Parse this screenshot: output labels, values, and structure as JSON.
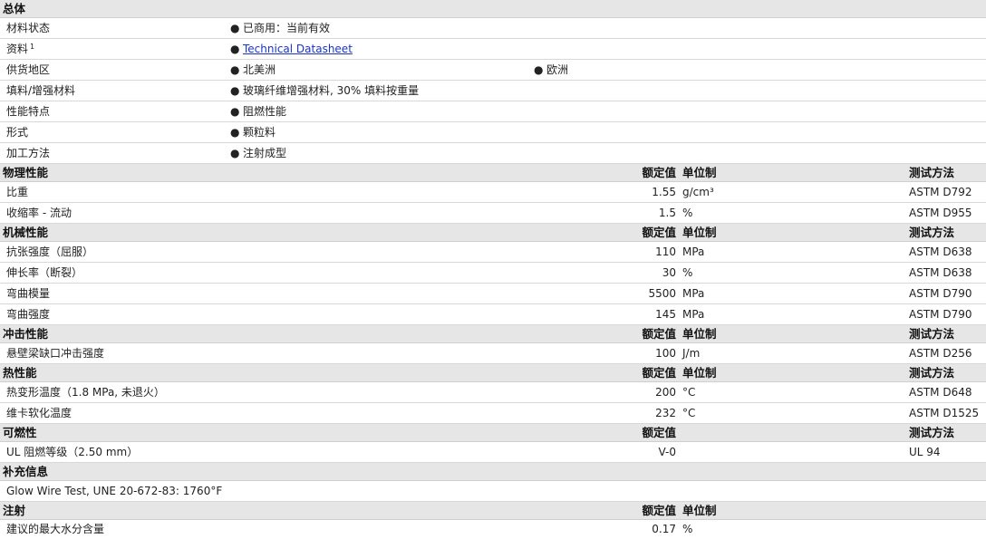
{
  "overview": {
    "title": "总体",
    "material_status": {
      "label": "材料状态",
      "value": "已商用：当前有效"
    },
    "literature": {
      "label": "资料",
      "footnote": "1",
      "link_text": "Technical Datasheet"
    },
    "availability": {
      "label": "供货地区",
      "values": [
        "北美洲",
        "欧洲"
      ]
    },
    "filler": {
      "label": "填料/增强材料",
      "value": "玻璃纤维增强材料, 30% 填料按重量"
    },
    "features": {
      "label": "性能特点",
      "value": "阻燃性能"
    },
    "form": {
      "label": "形式",
      "value": "颗粒料"
    },
    "processing": {
      "label": "加工方法",
      "value": "注射成型"
    }
  },
  "columns": {
    "nominal": "额定值",
    "unit": "单位制",
    "test": "测试方法"
  },
  "physical": {
    "title": "物理性能",
    "rows": [
      {
        "label": "比重",
        "value": "1.55",
        "unit": "g/cm³",
        "test": "ASTM D792"
      },
      {
        "label": "收缩率  - 流动",
        "value": "1.5",
        "unit": "%",
        "test": "ASTM D955"
      }
    ]
  },
  "mechanical": {
    "title": "机械性能",
    "rows": [
      {
        "label": "抗张强度（屈服）",
        "value": "110",
        "unit": "MPa",
        "test": "ASTM D638"
      },
      {
        "label": "伸长率（断裂）",
        "value": "30",
        "unit": "%",
        "test": "ASTM D638"
      },
      {
        "label": "弯曲模量",
        "value": "5500",
        "unit": "MPa",
        "test": "ASTM D790"
      },
      {
        "label": "弯曲强度",
        "value": "145",
        "unit": "MPa",
        "test": "ASTM D790"
      }
    ]
  },
  "impact": {
    "title": "冲击性能",
    "rows": [
      {
        "label": "悬壁梁缺口冲击强度",
        "value": "100",
        "unit": "J/m",
        "test": "ASTM D256"
      }
    ]
  },
  "thermal": {
    "title": "热性能",
    "rows": [
      {
        "label": "热变形温度（1.8 MPa, 未退火）",
        "value": "200",
        "unit": "°C",
        "test": "ASTM D648"
      },
      {
        "label": "维卡软化温度",
        "value": "232",
        "unit": "°C",
        "test": "ASTM D1525"
      }
    ]
  },
  "flammability": {
    "title": "可燃性",
    "rows": [
      {
        "label": "UL 阻燃等级（2.50 mm）",
        "value": "V-0",
        "test": "UL 94"
      }
    ]
  },
  "supplemental": {
    "title": "补充信息",
    "text": "Glow Wire Test, UNE 20-672-83: 1760°F"
  },
  "injection": {
    "title": "注射",
    "rows": [
      {
        "label": "建议的最大水分含量",
        "value": "0.17",
        "unit": "%"
      }
    ]
  }
}
